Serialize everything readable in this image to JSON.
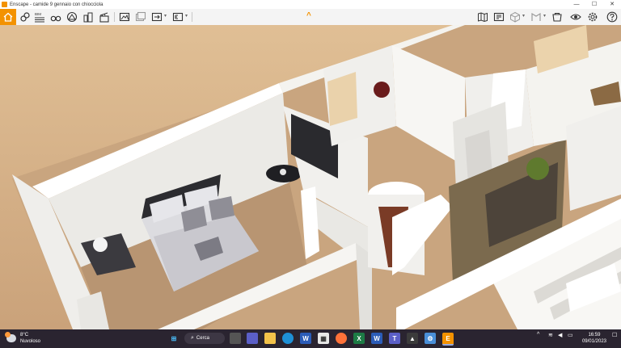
{
  "window": {
    "app_title": "Enscape - camide 9 gennaio con chiocciola",
    "minimize": "—",
    "maximize": "☐",
    "close": "✕"
  },
  "toolbar": {
    "left_icons": [
      "home-icon",
      "link-icon",
      "bim-icon",
      "binoculars-icon",
      "terrain-icon",
      "buildings-icon",
      "clapperboard-icon",
      "screenshot-icon",
      "batch-render-icon",
      "export-icon",
      "exe-export-icon"
    ],
    "bim_label": "BIM",
    "collapse_icon": "^",
    "right_icons": [
      "map-icon",
      "video-icon",
      "cube-icon",
      "material-icon",
      "asset-library-icon",
      "visibility-icon",
      "settings-icon",
      "help-icon"
    ]
  },
  "taskbar": {
    "weather_temp": "8°C",
    "weather_desc": "Nuvoloso",
    "search_label": "Cerca",
    "time": "16:59",
    "date": "09/01/2023",
    "apps": [
      "windows-start-icon",
      "task-view-icon",
      "teams-icon",
      "file-explorer-icon",
      "edge-icon",
      "word-icon",
      "store-icon",
      "firefox-icon",
      "excel-icon",
      "word-icon",
      "teams-icon",
      "photos-icon",
      "settings-icon",
      "enscape-icon"
    ]
  },
  "colors": {
    "accent": "#f39200",
    "taskbar": "#2a2430",
    "floor": "#c7a27d",
    "wall": "#f2f1ee"
  }
}
